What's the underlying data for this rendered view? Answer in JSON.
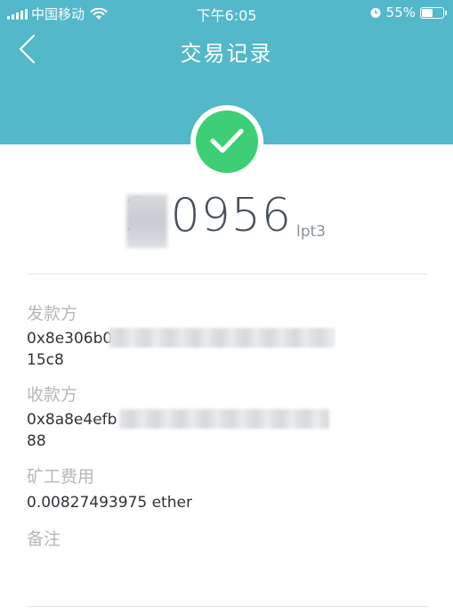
{
  "status_bar": {
    "carrier": "中国移动",
    "time": "下午6:05",
    "battery": "55%",
    "battery_level": 0.55
  },
  "nav": {
    "title": "交易记录"
  },
  "transaction": {
    "amount": "2.0956",
    "unit": "lpt3",
    "status_icon": "check-icon",
    "sender_label": "发款方",
    "sender_line1": "0x8e306b0                              c79d766cc",
    "sender_line2": "15c8",
    "receiver_label": "收款方",
    "receiver_line1": "0x8a8e4efb                              7f83d9c6cd",
    "receiver_line2": "88",
    "fee_label": "矿工费用",
    "fee_value": "0.00827493975 ether",
    "note_label": "备注"
  },
  "colors": {
    "header": "#53b8c9",
    "success": "#3ecf76",
    "label": "#b4b8bc",
    "text": "#2e3338"
  }
}
